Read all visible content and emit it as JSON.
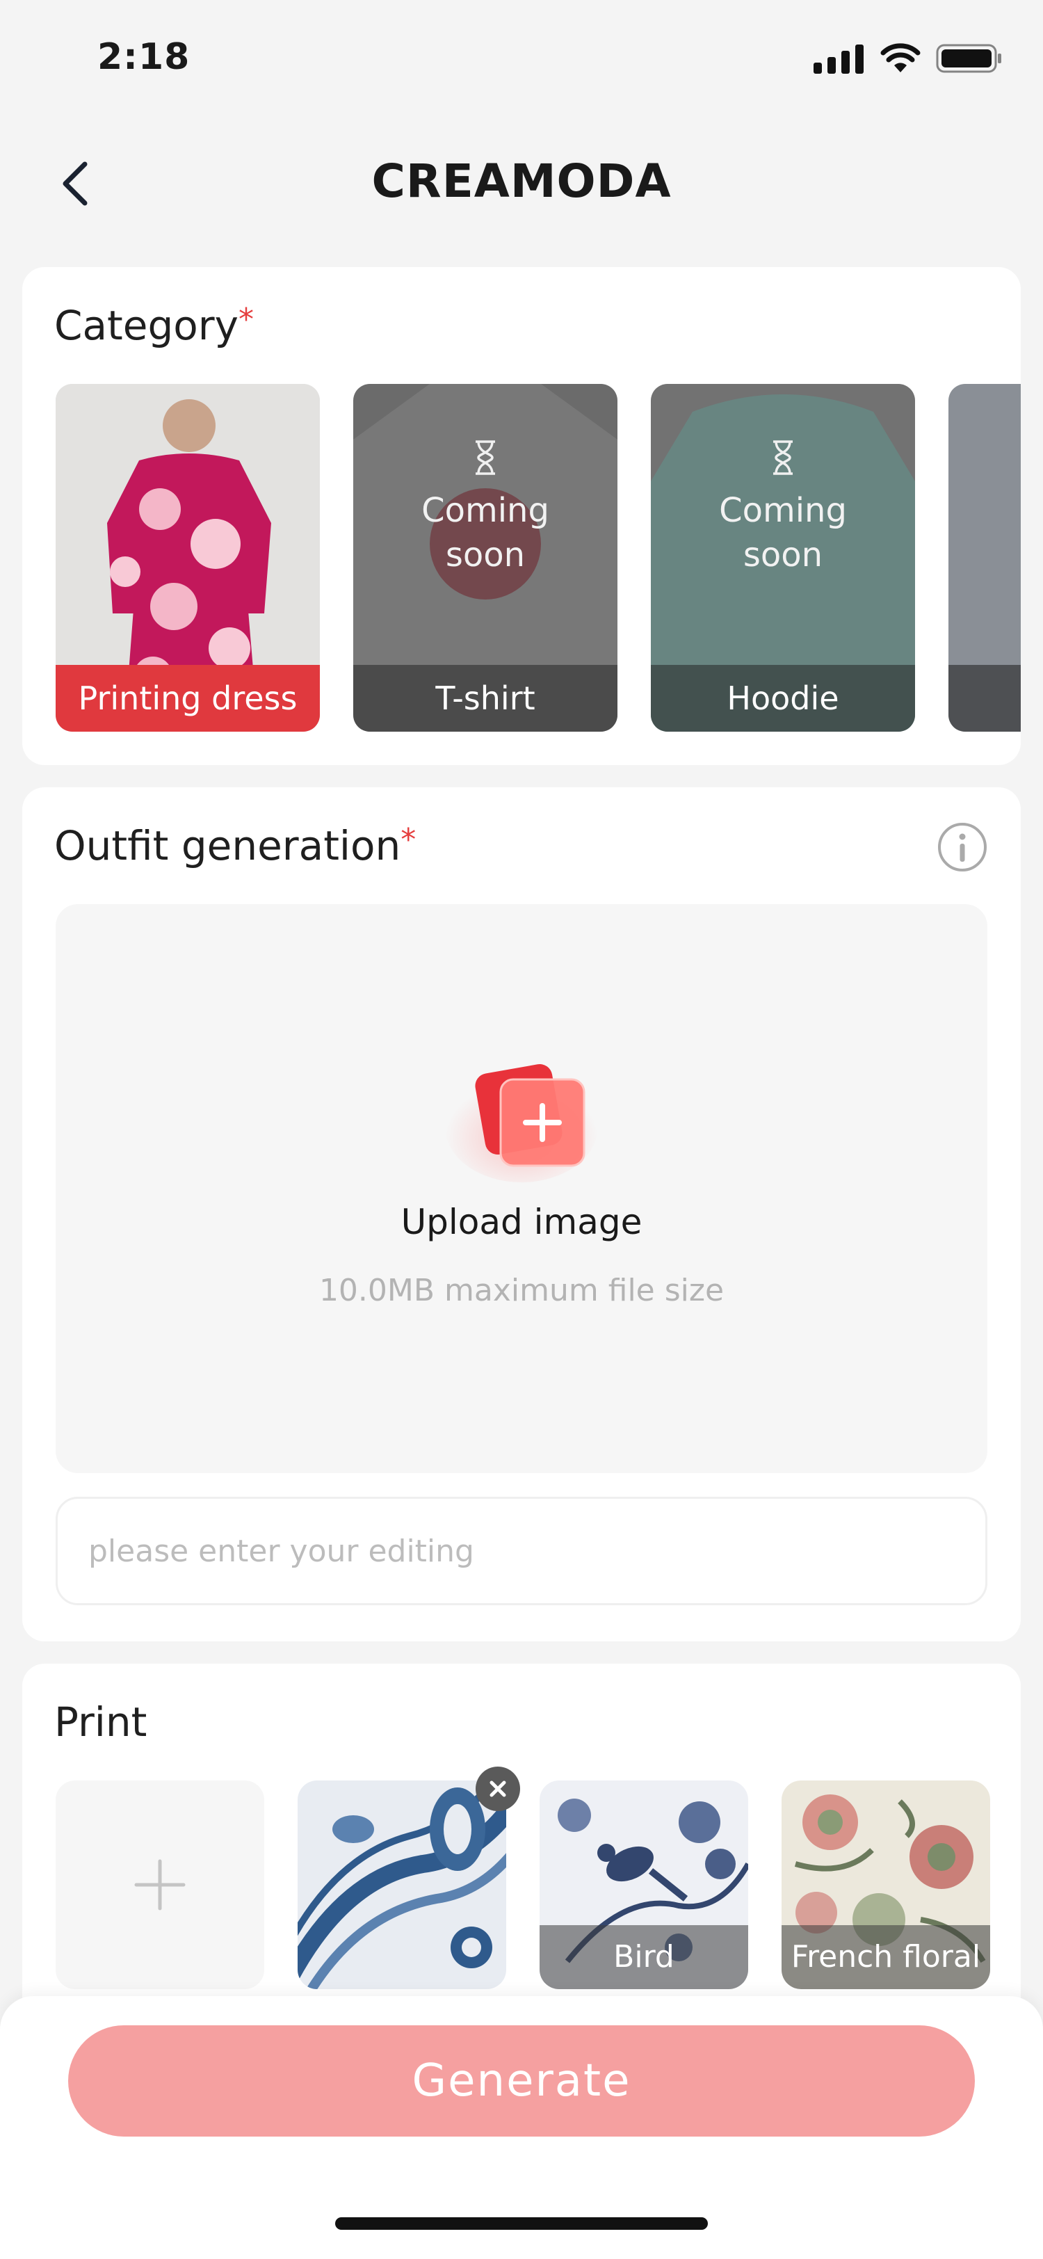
{
  "status": {
    "time": "2:18"
  },
  "header": {
    "title": "CREAMODA"
  },
  "category": {
    "title": "Category",
    "required_mark": "*",
    "items": [
      {
        "label": "Printing dress",
        "selected": true
      },
      {
        "label": "T-shirt",
        "overlay": "Coming soon"
      },
      {
        "label": "Hoodie",
        "overlay": "Coming soon"
      }
    ]
  },
  "outfit": {
    "title": "Outfit generation",
    "required_mark": "*",
    "upload_label": "Upload image",
    "upload_hint": "10.0MB maximum file size",
    "edit_placeholder": "please enter your editing"
  },
  "print": {
    "title": "Print",
    "items": [
      {
        "label": ""
      },
      {
        "label": "Bird"
      },
      {
        "label": "French floral"
      }
    ]
  },
  "footer": {
    "generate_label": "Generate"
  },
  "colors": {
    "accent": "#e0393e",
    "generate_bg": "#f5a0a0",
    "print_blue": "#2f5a8c"
  }
}
